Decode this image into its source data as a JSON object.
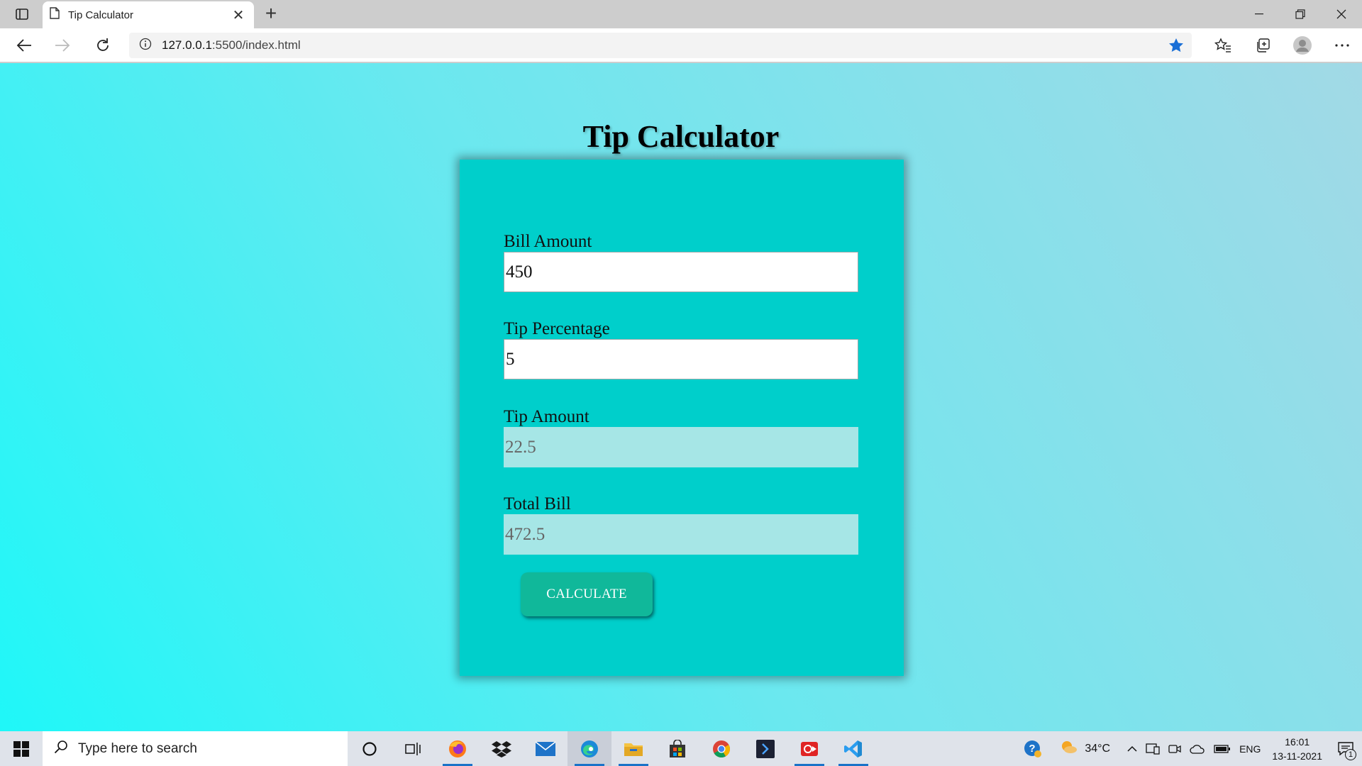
{
  "browser": {
    "tab_title": "Tip Calculator",
    "url_host": "127.0.0.1",
    "url_rest": ":5500/index.html"
  },
  "page": {
    "title": "Tip Calculator",
    "fields": {
      "bill_label": "Bill Amount",
      "bill_value": "450",
      "tip_pct_label": "Tip Percentage",
      "tip_pct_value": "5",
      "tip_amount_label": "Tip Amount",
      "tip_amount_value": "22.5",
      "total_label": "Total Bill",
      "total_value": "472.5"
    },
    "calculate_label": "CALCULATE"
  },
  "taskbar": {
    "search_placeholder": "Type here to search",
    "temperature": "34°C",
    "language": "ENG",
    "time": "16:01",
    "date": "13-11-2021",
    "notification_count": "1"
  },
  "colors": {
    "card": "#00cfcb",
    "button": "#10b89a",
    "readonly_field": "#a6e6e6"
  }
}
